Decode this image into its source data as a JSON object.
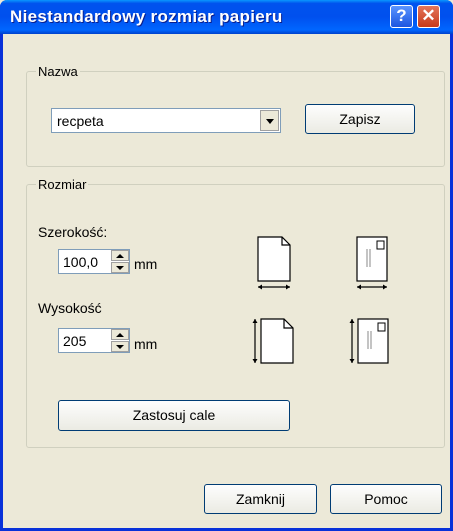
{
  "window": {
    "title": "Niestandardowy rozmiar papieru",
    "help_glyph": "?",
    "close_glyph": "✕"
  },
  "name_group": {
    "legend": "Nazwa",
    "selected": "recpeta",
    "save_label": "Zapisz"
  },
  "size_group": {
    "legend": "Rozmiar",
    "width_label": "Szerokość:",
    "width_value": "100,0",
    "width_unit": "mm",
    "height_label": "Wysokość",
    "height_value": "205",
    "height_unit": "mm",
    "apply_label": "Zastosuj cale"
  },
  "footer": {
    "close_label": "Zamknij",
    "help_label": "Pomoc"
  }
}
